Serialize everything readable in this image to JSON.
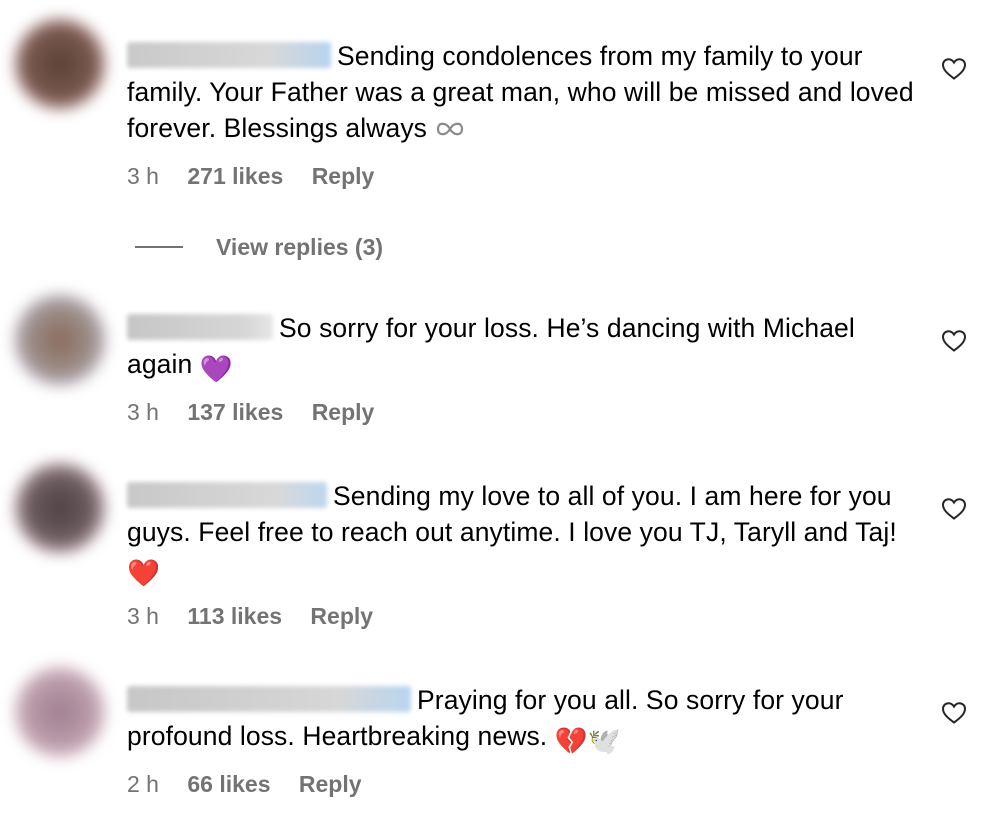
{
  "comments": [
    {
      "text": "Sending condolences from my family to your family. Your Father was a great man, who will be missed and loved forever. Blessings always",
      "emoji": "infinity",
      "time": "3 h",
      "likes": "271 likes",
      "reply": "Reply",
      "avatar_color": "#6e5149"
    },
    {
      "text": "So sorry for your loss. He’s dancing with Michael again",
      "emoji": "💜",
      "time": "3 h",
      "likes": "137 likes",
      "reply": "Reply",
      "avatar_color": "#8c7a72"
    },
    {
      "text": "Sending my love to all of you. I am here for you guys. Feel free to reach out anytime. I love you TJ, Taryll and Taj!",
      "emoji": "❤️",
      "time": "3 h",
      "likes": "113 likes",
      "reply": "Reply",
      "avatar_color": "#5d4d4f"
    },
    {
      "text": "Praying for you all. So sorry for your profound loss. Heartbreaking news.",
      "emoji": "💔🕊️",
      "time": "2 h",
      "likes": "66 likes",
      "reply": "Reply",
      "avatar_color": "#b89aa8"
    }
  ],
  "view_replies": "View replies (3)",
  "colors": {
    "meta_text": "#737373",
    "heart_stroke": "#262626"
  }
}
